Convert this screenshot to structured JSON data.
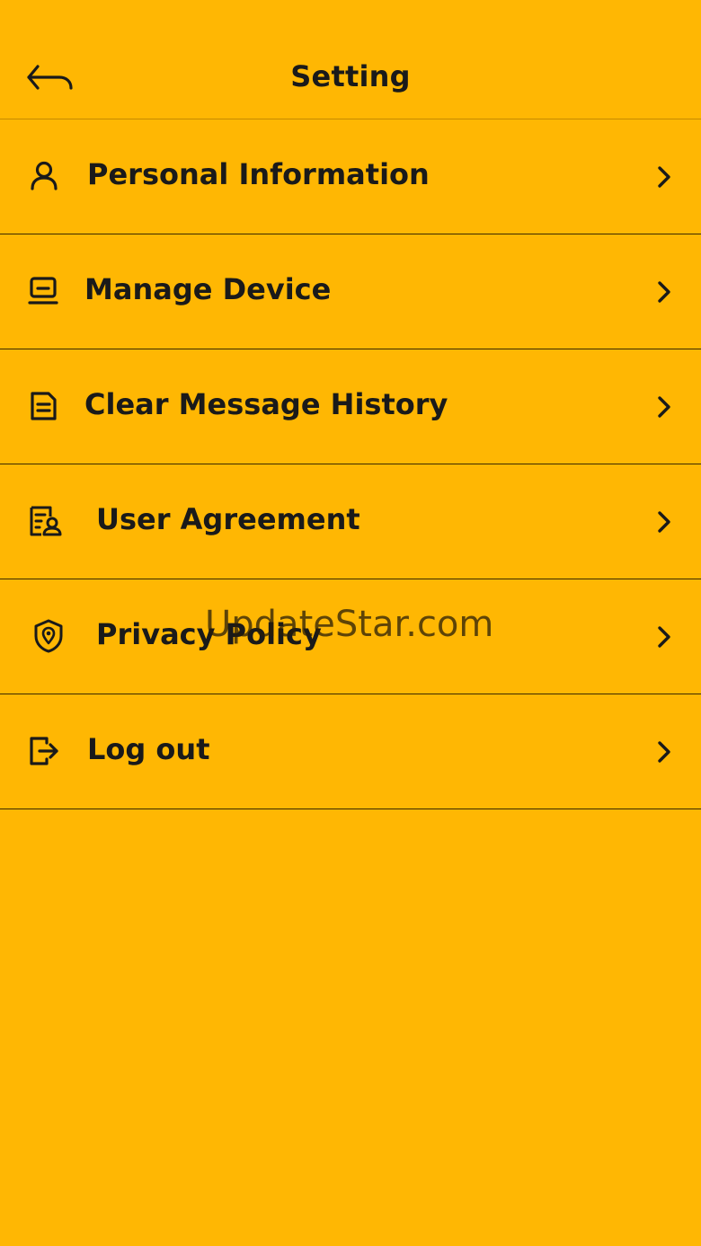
{
  "header": {
    "title": "Setting",
    "back_icon": "back-arrow-icon"
  },
  "menu": [
    {
      "id": "personal-information",
      "label": "Personal Information",
      "icon": "user-icon"
    },
    {
      "id": "manage-device",
      "label": "Manage Device",
      "icon": "device-icon"
    },
    {
      "id": "clear-message-history",
      "label": "Clear Message History",
      "icon": "document-icon"
    },
    {
      "id": "user-agreement",
      "label": "User Agreement",
      "icon": "agreement-icon"
    },
    {
      "id": "privacy-policy",
      "label": "Privacy Policy",
      "icon": "shield-location-icon"
    },
    {
      "id": "log-out",
      "label": "Log out",
      "icon": "logout-icon"
    }
  ],
  "watermark": "UpdateStar.com",
  "colors": {
    "background": "#FFB703",
    "text": "#1A1A1A"
  }
}
